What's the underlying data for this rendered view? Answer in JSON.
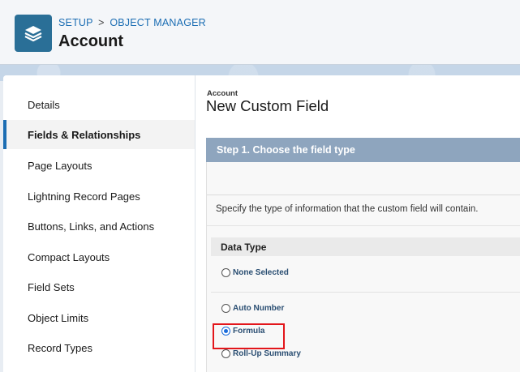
{
  "header": {
    "breadcrumb": {
      "setup": "SETUP",
      "separator": ">",
      "object_manager": "OBJECT MANAGER"
    },
    "title": "Account",
    "icon": "layers-icon"
  },
  "sidebar": {
    "items": [
      {
        "label": "Details",
        "active": false
      },
      {
        "label": "Fields & Relationships",
        "active": true
      },
      {
        "label": "Page Layouts",
        "active": false
      },
      {
        "label": "Lightning Record Pages",
        "active": false
      },
      {
        "label": "Buttons, Links, and Actions",
        "active": false
      },
      {
        "label": "Compact Layouts",
        "active": false
      },
      {
        "label": "Field Sets",
        "active": false
      },
      {
        "label": "Object Limits",
        "active": false
      },
      {
        "label": "Record Types",
        "active": false
      }
    ]
  },
  "main": {
    "object_label": "Account",
    "heading": "New Custom Field",
    "step_title": "Step 1. Choose the field type",
    "instructions": "Specify the type of information that the custom field will contain.",
    "data_type_header": "Data Type",
    "options": [
      {
        "label": "None Selected",
        "selected": false
      },
      {
        "label": "Auto Number",
        "selected": false
      },
      {
        "label": "Formula",
        "selected": true
      },
      {
        "label": "Roll-Up Summary",
        "selected": false
      }
    ]
  },
  "colors": {
    "accent": "#1b6db3",
    "header_icon_bg": "#2a6f97",
    "step_bar": "#8ea5be",
    "highlight": "#e3161b"
  }
}
